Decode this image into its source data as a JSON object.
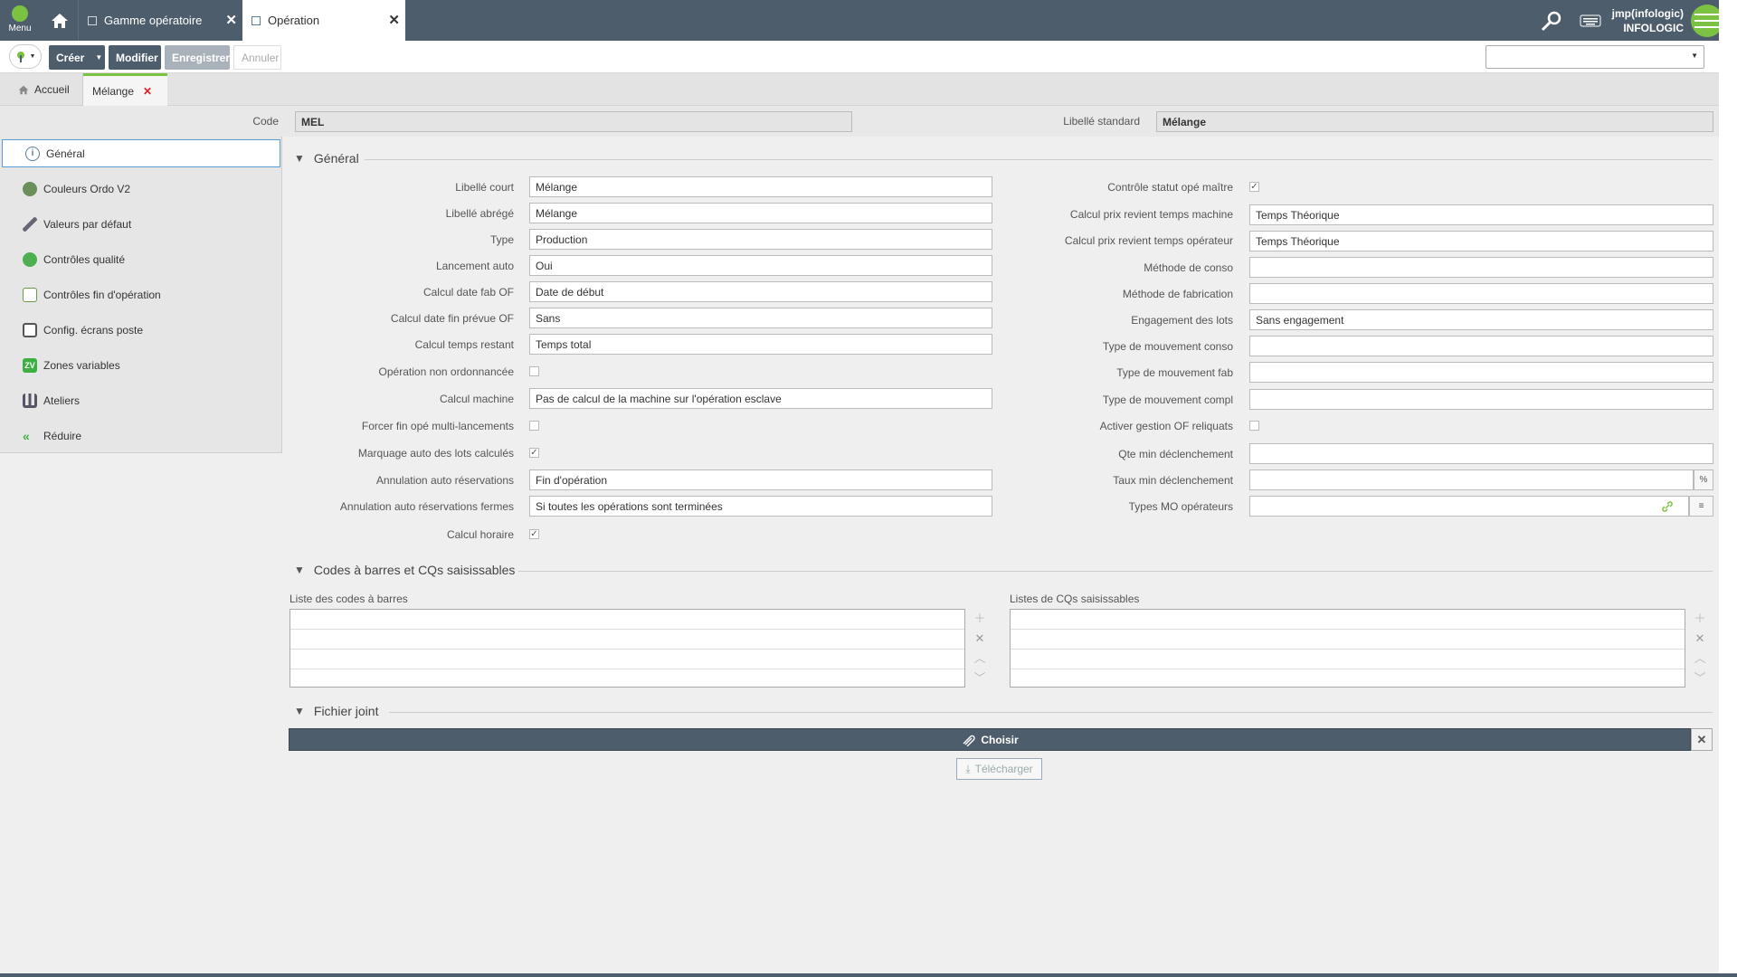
{
  "app": {
    "menu_label": "Menu",
    "user_name": "jmp(infologic)",
    "company": "INFOLOGIC"
  },
  "window_tabs": [
    {
      "label": "Gamme opératoire",
      "close": "✕"
    },
    {
      "label": "Opération",
      "close": "✕"
    }
  ],
  "toolbar": {
    "create_label": "Créer",
    "modify_label": "Modifier",
    "save_label": "Enregistrer",
    "cancel_label": "Annuler",
    "select_value": ""
  },
  "content_tabs": [
    {
      "label": "Accueil"
    },
    {
      "label": "Mélange",
      "close": "✕"
    }
  ],
  "header": {
    "code_label": "Code",
    "code_value": "MEL",
    "libelle_label": "Libellé standard",
    "libelle_value": "Mélange"
  },
  "sidebar": {
    "items": [
      {
        "label": "Général",
        "icon": "info-icon"
      },
      {
        "label": "Couleurs Ordo V2",
        "icon": "palette-icon"
      },
      {
        "label": "Valeurs par défaut",
        "icon": "brush-icon"
      },
      {
        "label": "Contrôles qualité",
        "icon": "quality-icon"
      },
      {
        "label": "Contrôles fin d'opération",
        "icon": "checklist-icon"
      },
      {
        "label": "Config. écrans poste",
        "icon": "screen-icon"
      },
      {
        "label": "Zones variables",
        "icon": "zv-icon"
      },
      {
        "label": "Ateliers",
        "icon": "workshop-icon"
      },
      {
        "label": "Réduire",
        "icon": "collapse-icon"
      }
    ]
  },
  "sections": {
    "general": "Général",
    "barcodes": "Codes à barres et CQs saisissables",
    "attachment": "Fichier joint"
  },
  "left_fields": [
    {
      "label": "Libellé court",
      "value": "Mélange",
      "type": "text"
    },
    {
      "label": "Libellé abrégé",
      "value": "Mélange",
      "type": "text"
    },
    {
      "label": "Type",
      "value": "Production",
      "type": "text"
    },
    {
      "label": "Lancement auto",
      "value": "Oui",
      "type": "text"
    },
    {
      "label": "Calcul date fab OF",
      "value": "Date de début",
      "type": "text"
    },
    {
      "label": "Calcul date fin prévue OF",
      "value": "Sans",
      "type": "text"
    },
    {
      "label": "Calcul temps restant",
      "value": "Temps total",
      "type": "text"
    },
    {
      "label": "Opération non ordonnancée",
      "checked": false,
      "type": "check"
    },
    {
      "label": "Calcul machine",
      "value": "Pas de calcul de la machine sur l'opération esclave",
      "type": "text"
    },
    {
      "label": "Forcer fin opé multi-lancements",
      "checked": false,
      "type": "check"
    },
    {
      "label": "Marquage auto des lots calculés",
      "checked": true,
      "type": "check"
    },
    {
      "label": "Annulation auto réservations",
      "value": "Fin d'opération",
      "type": "text"
    },
    {
      "label": "Annulation auto réservations fermes",
      "value": "Si toutes les opérations sont terminées",
      "type": "text"
    },
    {
      "label": "Calcul horaire",
      "checked": true,
      "type": "check"
    }
  ],
  "right_fields": [
    {
      "label": "Contrôle statut opé maître",
      "checked": true,
      "type": "check"
    },
    {
      "label": "Calcul prix revient temps machine",
      "value": "Temps Théorique",
      "type": "text"
    },
    {
      "label": "Calcul prix revient temps opérateur",
      "value": "Temps Théorique",
      "type": "text"
    },
    {
      "label": "Méthode de conso",
      "value": "",
      "type": "text"
    },
    {
      "label": "Méthode de fabrication",
      "value": "",
      "type": "text"
    },
    {
      "label": "Engagement des lots",
      "value": "Sans engagement",
      "type": "text"
    },
    {
      "label": "Type de mouvement conso",
      "value": "",
      "type": "text"
    },
    {
      "label": "Type de mouvement fab",
      "value": "",
      "type": "text"
    },
    {
      "label": "Type de mouvement compl",
      "value": "",
      "type": "text"
    },
    {
      "label": "Activer gestion OF reliquats",
      "checked": false,
      "type": "check"
    },
    {
      "label": "Qte min déclenchement",
      "value": "",
      "type": "text"
    },
    {
      "label": "Taux min déclenchement",
      "value": "",
      "type": "text",
      "suffix": "%"
    },
    {
      "label": "Types MO opérateurs",
      "value": "",
      "type": "text",
      "suffix": "≡"
    }
  ],
  "lists": {
    "barcodes_label": "Liste des codes à barres",
    "cq_label": "Listes de CQs saisissables"
  },
  "attachment": {
    "choose_label": "Choisir",
    "download_label": "Télécharger"
  }
}
